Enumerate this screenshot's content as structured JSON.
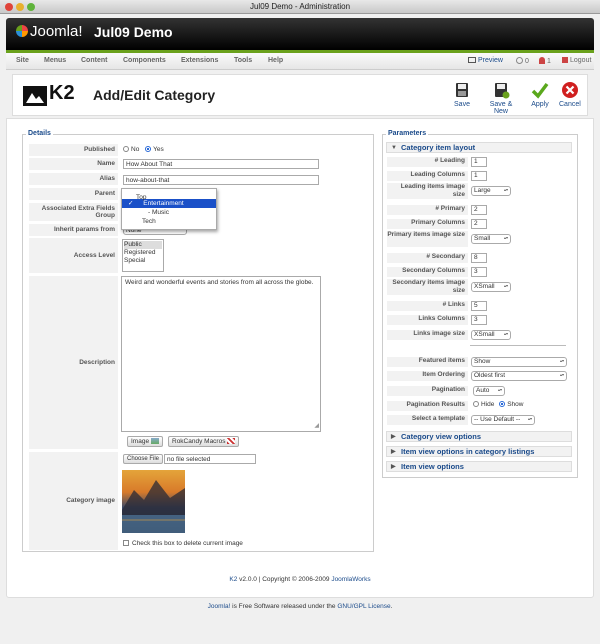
{
  "window": {
    "title": "Jul09 Demo - Administration"
  },
  "header": {
    "brand": "Joomla!",
    "site_name": "Jul09 Demo"
  },
  "menu": {
    "items": [
      "Site",
      "Menus",
      "Content",
      "Components",
      "Extensions",
      "Tools",
      "Help"
    ],
    "right": {
      "preview": "Preview",
      "messages": "0",
      "users": "1",
      "logout": "Logout"
    }
  },
  "toolbar": {
    "logo": "K2",
    "title": "Add/Edit Category",
    "buttons": {
      "save": "Save",
      "save_new": "Save & New",
      "apply": "Apply",
      "cancel": "Cancel"
    }
  },
  "details": {
    "legend": "Details",
    "published": {
      "label": "Published",
      "no": "No",
      "yes": "Yes",
      "selected": "Yes"
    },
    "name": {
      "label": "Name",
      "value": "How About That"
    },
    "alias": {
      "label": "Alias",
      "value": "how-about-that"
    },
    "parent": {
      "label": "Parent",
      "options": [
        "Top",
        "Entertainment",
        "- Music",
        "Tech"
      ],
      "selected": "Entertainment"
    },
    "extra_fields": {
      "label": "Associated Extra Fields Group"
    },
    "inherit": {
      "label": "Inherit params from",
      "value": "None"
    },
    "access": {
      "label": "Access Level",
      "options": [
        "Public",
        "Registered",
        "Special"
      ]
    },
    "description": {
      "label": "Description",
      "value": "Weird and wonderful events and stories from all across the globe."
    },
    "editor_buttons": {
      "image": "Image",
      "macros": "RokCandy Macros"
    },
    "category_image": {
      "label": "Category image",
      "choose": "Choose File",
      "nofile": "no file selected",
      "delete_label": "Check this box to delete current image"
    }
  },
  "parameters": {
    "legend": "Parameters",
    "layout": {
      "title": "Category item layout",
      "rows": [
        {
          "label": "# Leading",
          "value": "1",
          "kind": "input"
        },
        {
          "label": "Leading Columns",
          "value": "1",
          "kind": "input"
        },
        {
          "label": "Leading items image size",
          "value": "Large",
          "kind": "select"
        },
        {
          "label": "# Primary",
          "value": "2",
          "kind": "input"
        },
        {
          "label": "Primary Columns",
          "value": "2",
          "kind": "input"
        },
        {
          "label": "Primary items image size",
          "value": "Small",
          "kind": "select"
        },
        {
          "label": "# Secondary",
          "value": "8",
          "kind": "input"
        },
        {
          "label": "Secondary Columns",
          "value": "3",
          "kind": "input"
        },
        {
          "label": "Secondary items image size",
          "value": "XSmall",
          "kind": "select"
        },
        {
          "label": "# Links",
          "value": "5",
          "kind": "input"
        },
        {
          "label": "Links Columns",
          "value": "3",
          "kind": "input"
        },
        {
          "label": "Links image size",
          "value": "XSmall",
          "kind": "select"
        }
      ],
      "featured": {
        "label": "Featured items",
        "value": "Show"
      },
      "ordering": {
        "label": "Item Ordering",
        "value": "Oldest first"
      },
      "pagination": {
        "label": "Pagination",
        "value": "Auto"
      },
      "pagination_results": {
        "label": "Pagination Results",
        "hide": "Hide",
        "show": "Show",
        "selected": "Show"
      },
      "template": {
        "label": "Select a template",
        "value": "-- Use Default --"
      }
    },
    "collapsed": [
      "Category view options",
      "Item view options in category listings",
      "Item view options"
    ]
  },
  "footer": {
    "version": {
      "k2": "K2",
      "text": " v2.0.0 | Copyright © 2006-2009 ",
      "works": "JoomlaWorks"
    },
    "bottom": {
      "joomla": "Joomla!",
      "text": " is Free Software released under the ",
      "license": "GNU/GPL License",
      "end": "."
    }
  },
  "colors": {
    "accent": "#1a4a8a",
    "green": "#6aa11c",
    "header": "#000000"
  }
}
